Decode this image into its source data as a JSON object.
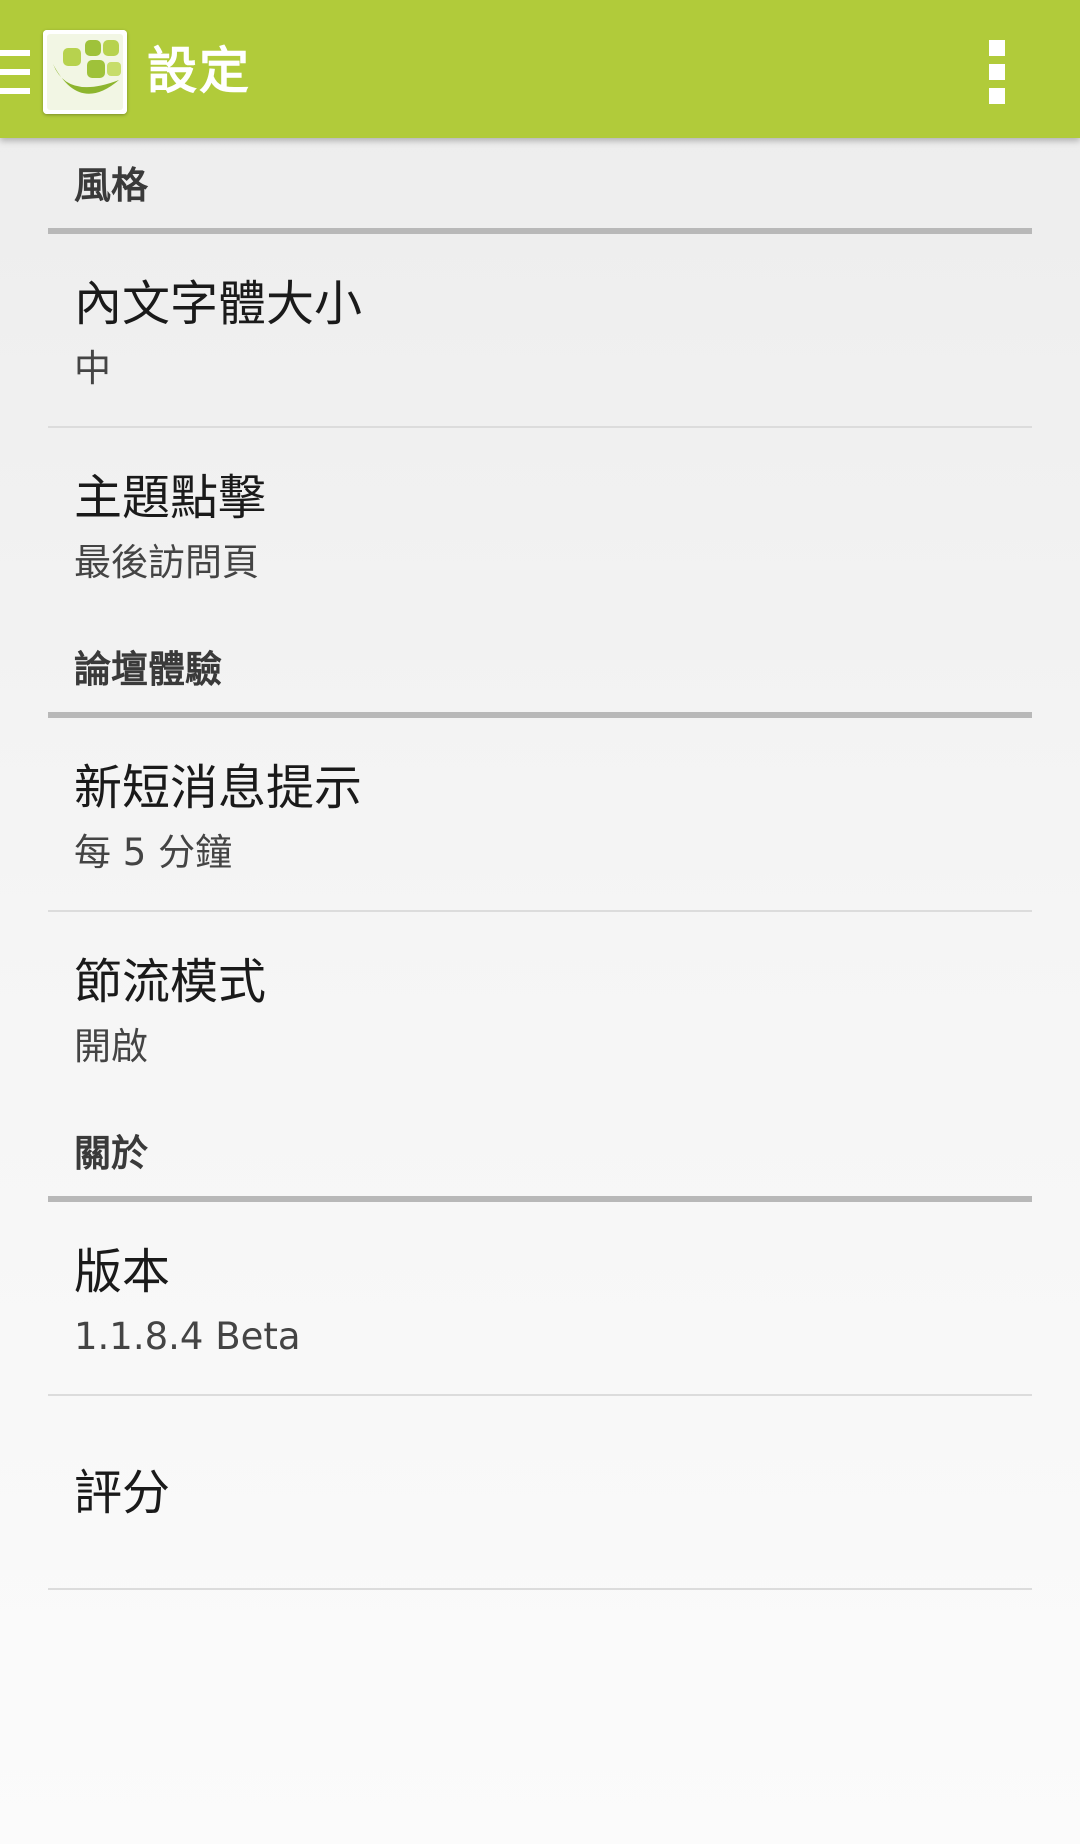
{
  "app_bar": {
    "title": "設定",
    "background_color": "#b1cb3a",
    "menu_icon": "hamburger-menu-icon",
    "logo_icon": "app-logo-icon",
    "overflow_icon": "overflow-menu-icon"
  },
  "categories": [
    {
      "title": "風格",
      "items": [
        {
          "title": "內文字體大小",
          "summary": "中"
        },
        {
          "title": "主題點擊",
          "summary": "最後訪問頁"
        }
      ]
    },
    {
      "title": "論壇體驗",
      "items": [
        {
          "title": "新短消息提示",
          "summary": "每 5 分鐘"
        },
        {
          "title": "節流模式",
          "summary": "開啟"
        }
      ]
    },
    {
      "title": "關於",
      "items": [
        {
          "title": "版本",
          "summary": "1.1.8.4 Beta"
        },
        {
          "title": "評分"
        }
      ]
    }
  ]
}
